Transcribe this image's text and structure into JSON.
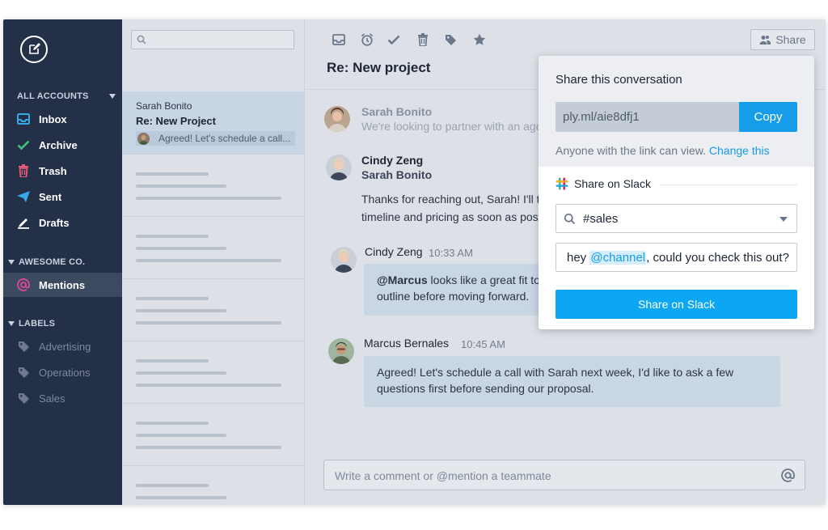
{
  "sidebar": {
    "sections": {
      "all_accounts": "ALL ACCOUNTS",
      "awesome": "AWESOME CO.",
      "labels": "LABELS"
    },
    "items": [
      {
        "label": "Inbox",
        "icon": "inbox-icon"
      },
      {
        "label": "Archive",
        "icon": "check-icon"
      },
      {
        "label": "Trash",
        "icon": "trash-icon"
      },
      {
        "label": "Sent",
        "icon": "paper-plane-icon"
      },
      {
        "label": "Drafts",
        "icon": "pencil-icon"
      }
    ],
    "team_items": [
      {
        "label": "Mentions",
        "icon": "at-icon"
      }
    ],
    "label_items": [
      {
        "label": "Advertising",
        "icon": "tag-icon"
      },
      {
        "label": "Operations",
        "icon": "tag-icon"
      },
      {
        "label": "Sales",
        "icon": "tag-icon"
      }
    ]
  },
  "list": {
    "search_value": "",
    "selected": {
      "from": "Sarah Bonito",
      "subject": "Re:  New Project",
      "preview": "Agreed! Let's schedule a call..."
    }
  },
  "toolbar": {
    "icons": [
      "inbox-icon",
      "alarm-clock-icon",
      "check-icon",
      "trash-icon",
      "tag-icon",
      "star-icon"
    ],
    "share_label": "Share"
  },
  "conversation": {
    "title": "Re: New project",
    "messages": [
      {
        "name": "Sarah Bonito",
        "preview": "We're looking to partner with an age"
      },
      {
        "name": "Cindy Zeng",
        "to": "Sarah Bonito",
        "body1": "Thanks for reaching out, Sarah! I'll ta",
        "body2": "timeline and pricing as soon as poss"
      }
    ],
    "comments": [
      {
        "name": "Cindy Zeng",
        "time": "10:33 AM",
        "mention": "@Marcus",
        "text1": " looks like a great fit to",
        "text2": "outline before moving forward."
      },
      {
        "name": "Marcus Bernales",
        "time": "10:45 AM",
        "text1": "Agreed! Let's schedule a call with Sarah next week, I'd like to ask a few",
        "text2": "questions first before sending our proposal."
      }
    ],
    "comment_placeholder": "Write a comment or @mention a teammate"
  },
  "share_popover": {
    "title": "Share this conversation",
    "link": "ply.ml/aie8dfj1",
    "copy_label": "Copy",
    "note": "Anyone with the link can view. ",
    "change_link": "Change this",
    "slack": {
      "header": "Share on Slack",
      "channel": "#sales",
      "message_prefix": "hey ",
      "message_mention": "@channel",
      "message_suffix": ", could you check this out?",
      "button_label": "Share on Slack"
    }
  },
  "colors": {
    "sidebar_bg": "#233048",
    "accent_blue": "#169ce8",
    "slack_button": "#0ba7f3",
    "mention_pink": "#e4479b"
  }
}
